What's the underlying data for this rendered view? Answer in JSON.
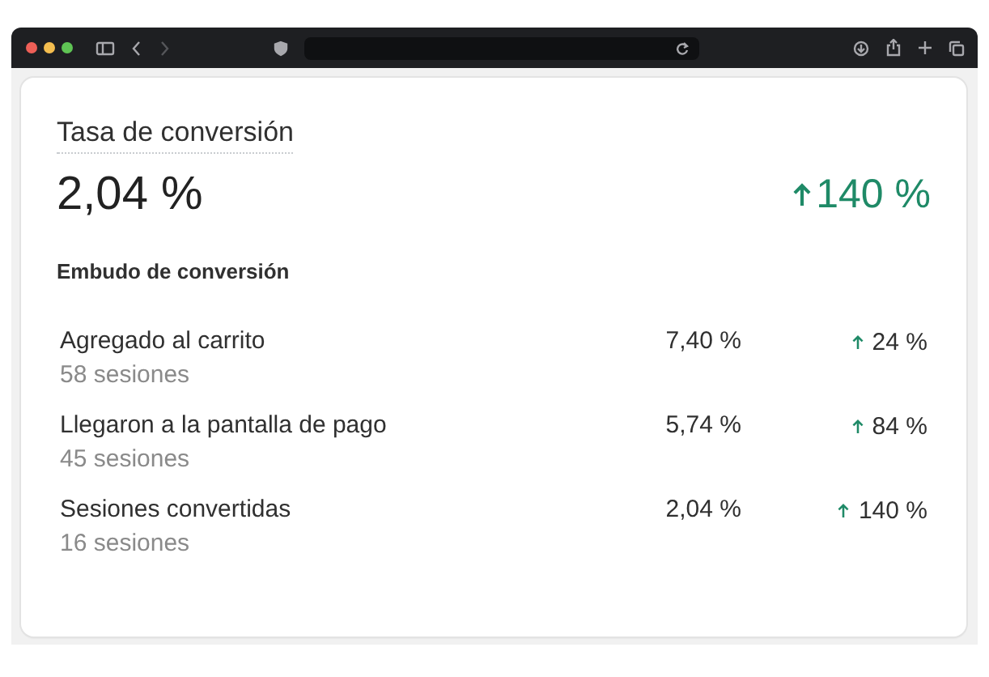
{
  "card": {
    "title": "Tasa de conversión",
    "value": "2,04 %",
    "change": "140 %",
    "funnel_title": "Embudo de conversión",
    "steps": [
      {
        "label": "Agregado al carrito",
        "sessions": "58 sesiones",
        "rate": "7,40 %",
        "change": "24 %"
      },
      {
        "label": "Llegaron a la pantalla de pago",
        "sessions": "45 sesiones",
        "rate": "5,74 %",
        "change": "84 %"
      },
      {
        "label": "Sesiones convertidas",
        "sessions": "16 sesiones",
        "rate": "2,04 %",
        "change": "140 %"
      }
    ]
  }
}
